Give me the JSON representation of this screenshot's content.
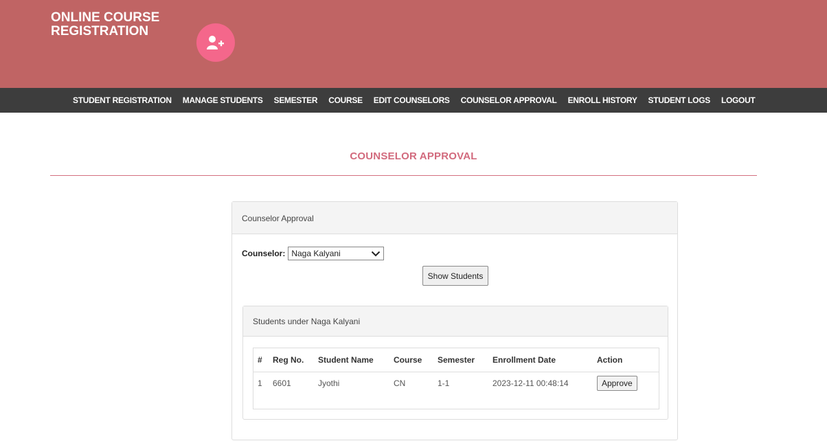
{
  "header": {
    "brand_title": "ONLINE COURSE REGISTRATION",
    "brand_icon": "user-plus-icon",
    "bg_color": "#c06464",
    "icon_bg_color": "#f4678b"
  },
  "nav": {
    "items": [
      {
        "label": "STUDENT REGISTRATION"
      },
      {
        "label": "MANAGE STUDENTS"
      },
      {
        "label": "SEMESTER"
      },
      {
        "label": "COURSE"
      },
      {
        "label": "EDIT COUNSELORS"
      },
      {
        "label": "COUNSELOR APPROVAL"
      },
      {
        "label": "ENROLL HISTORY"
      },
      {
        "label": "STUDENT LOGS"
      },
      {
        "label": "LOGOUT"
      }
    ],
    "bg_color": "#3d3d3d"
  },
  "page": {
    "title": "COUNSELOR APPROVAL",
    "accent_color": "#d26a7d"
  },
  "panel": {
    "heading": "Counselor Approval",
    "counselor_label": "Counselor:",
    "counselor_selected": "Naga Kalyani",
    "show_button": "Show Students"
  },
  "students_panel": {
    "heading": "Students under Naga Kalyani",
    "columns": [
      "#",
      "Reg No.",
      "Student Name",
      "Course",
      "Semester",
      "Enrollment Date",
      "Action"
    ],
    "rows": [
      {
        "index": "1",
        "reg_no": "6601",
        "student_name": "Jyothi",
        "course": "CN",
        "semester": "1-1",
        "enrollment_date": "2023-12-11 00:48:14",
        "action": "Approve"
      }
    ]
  }
}
